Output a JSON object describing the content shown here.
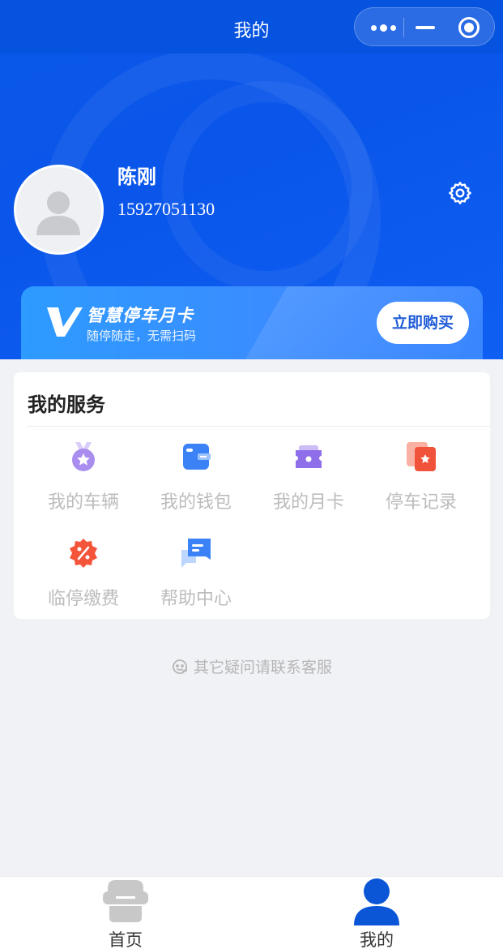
{
  "navbar": {
    "title": "我的",
    "capsule": {
      "more_icon": "more-dots-icon",
      "minimize_icon": "minimize-icon",
      "close_icon": "target-close-icon"
    }
  },
  "profile": {
    "name": "陈刚",
    "phone": "15927051130",
    "avatar_icon": "default-avatar-icon",
    "settings_icon": "gear-icon"
  },
  "banner": {
    "logo_icon": "v-logo-icon",
    "title": "智慧停车月卡",
    "subtitle": "随停随走，无需扫码",
    "button": "立即购买"
  },
  "services": {
    "title": "我的服务",
    "items": [
      {
        "label": "我的车辆",
        "icon": "medal-star-icon"
      },
      {
        "label": "我的钱包",
        "icon": "wallet-icon"
      },
      {
        "label": "我的月卡",
        "icon": "ticket-card-icon"
      },
      {
        "label": "停车记录",
        "icon": "record-star-icon"
      },
      {
        "label": "临停缴费",
        "icon": "discount-badge-icon"
      },
      {
        "label": "帮助中心",
        "icon": "chat-help-icon"
      }
    ]
  },
  "contact": {
    "text": "其它疑问请联系客服",
    "icon": "customer-service-icon"
  },
  "tabbar": {
    "items": [
      {
        "label": "首页",
        "icon": "home-car-icon",
        "active": false
      },
      {
        "label": "我的",
        "icon": "user-icon",
        "active": true
      }
    ]
  },
  "colors": {
    "primary": "#0a56ea",
    "active_tab": "#0a56d6",
    "inactive_tab": "#c8c8c8"
  }
}
